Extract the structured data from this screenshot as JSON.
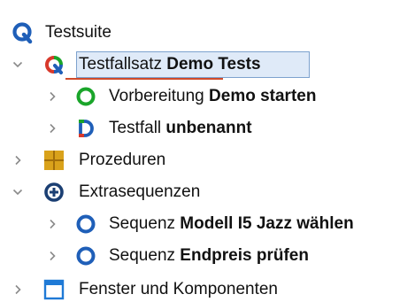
{
  "tree": {
    "root": {
      "label": "Testsuite",
      "icon": "qf-test-logo-icon"
    },
    "nodes": [
      {
        "id": "testfallsatz",
        "prefix": "Testfallsatz",
        "name": "Demo Tests",
        "icon": "testset-icon",
        "expanded": true,
        "selected": true
      },
      {
        "id": "vorbereitung",
        "prefix": "Vorbereitung",
        "name": "Demo starten",
        "icon": "green-ring-icon",
        "expanded": false
      },
      {
        "id": "testfall",
        "prefix": "Testfall",
        "name": "unbenannt",
        "icon": "testcase-icon",
        "expanded": false
      },
      {
        "id": "prozeduren",
        "prefix": "Prozeduren",
        "name": "",
        "icon": "procedures-icon",
        "expanded": false
      },
      {
        "id": "extrasequenzen",
        "prefix": "Extrasequenzen",
        "name": "",
        "icon": "plus-circle-icon",
        "expanded": true
      },
      {
        "id": "sequenz1",
        "prefix": "Sequenz",
        "name": "Modell I5 Jazz wählen",
        "icon": "blue-ring-icon",
        "expanded": false
      },
      {
        "id": "sequenz2",
        "prefix": "Sequenz",
        "name": "Endpreis prüfen",
        "icon": "blue-ring-icon",
        "expanded": false
      },
      {
        "id": "fenster",
        "prefix": "Fenster und Komponenten",
        "name": "",
        "icon": "windows-icon",
        "expanded": false
      }
    ]
  },
  "colors": {
    "green": "#1aa52a",
    "blue": "#1f5fb8",
    "red": "#d8392b",
    "gold": "#d9a21b",
    "selection_bg": "#dfeaf8",
    "selection_border": "#7da2ce",
    "toggle": "#8a8a8a"
  }
}
